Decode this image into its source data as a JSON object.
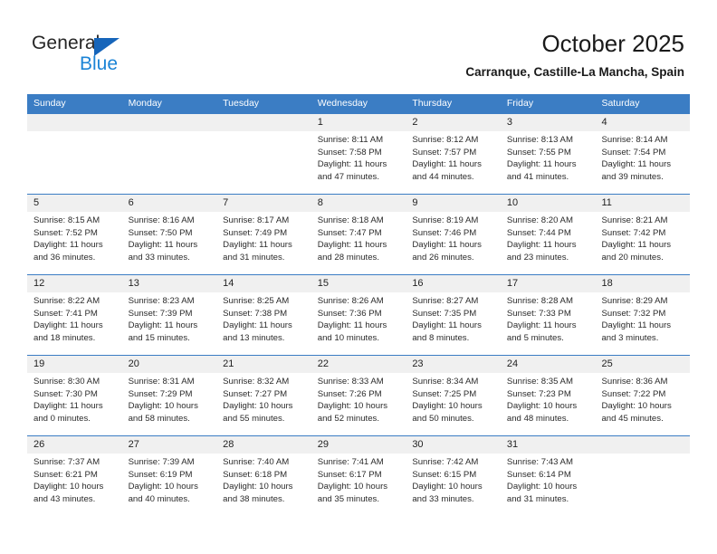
{
  "brand": {
    "name_part1": "General",
    "name_part2": "Blue",
    "triangle_color": "#1665ba",
    "blue_color": "#1c84d6"
  },
  "header": {
    "title": "October 2025",
    "subtitle": "Carranque, Castille-La Mancha, Spain"
  },
  "colors": {
    "header_blue": "#3b7dc4",
    "row_band_gray": "#f0f0f0",
    "text": "#2b2b2b"
  },
  "weekdays": [
    "Sunday",
    "Monday",
    "Tuesday",
    "Wednesday",
    "Thursday",
    "Friday",
    "Saturday"
  ],
  "labels": {
    "sunrise_prefix": "Sunrise: ",
    "sunset_prefix": "Sunset: ",
    "daylight_prefix": "Daylight: "
  },
  "weeks": [
    [
      {
        "day": "",
        "empty": true
      },
      {
        "day": "",
        "empty": true
      },
      {
        "day": "",
        "empty": true
      },
      {
        "day": "1",
        "sunrise": "Sunrise: 8:11 AM",
        "sunset": "Sunset: 7:58 PM",
        "daylight_1": "Daylight: 11 hours",
        "daylight_2": "and 47 minutes."
      },
      {
        "day": "2",
        "sunrise": "Sunrise: 8:12 AM",
        "sunset": "Sunset: 7:57 PM",
        "daylight_1": "Daylight: 11 hours",
        "daylight_2": "and 44 minutes."
      },
      {
        "day": "3",
        "sunrise": "Sunrise: 8:13 AM",
        "sunset": "Sunset: 7:55 PM",
        "daylight_1": "Daylight: 11 hours",
        "daylight_2": "and 41 minutes."
      },
      {
        "day": "4",
        "sunrise": "Sunrise: 8:14 AM",
        "sunset": "Sunset: 7:54 PM",
        "daylight_1": "Daylight: 11 hours",
        "daylight_2": "and 39 minutes."
      }
    ],
    [
      {
        "day": "5",
        "sunrise": "Sunrise: 8:15 AM",
        "sunset": "Sunset: 7:52 PM",
        "daylight_1": "Daylight: 11 hours",
        "daylight_2": "and 36 minutes."
      },
      {
        "day": "6",
        "sunrise": "Sunrise: 8:16 AM",
        "sunset": "Sunset: 7:50 PM",
        "daylight_1": "Daylight: 11 hours",
        "daylight_2": "and 33 minutes."
      },
      {
        "day": "7",
        "sunrise": "Sunrise: 8:17 AM",
        "sunset": "Sunset: 7:49 PM",
        "daylight_1": "Daylight: 11 hours",
        "daylight_2": "and 31 minutes."
      },
      {
        "day": "8",
        "sunrise": "Sunrise: 8:18 AM",
        "sunset": "Sunset: 7:47 PM",
        "daylight_1": "Daylight: 11 hours",
        "daylight_2": "and 28 minutes."
      },
      {
        "day": "9",
        "sunrise": "Sunrise: 8:19 AM",
        "sunset": "Sunset: 7:46 PM",
        "daylight_1": "Daylight: 11 hours",
        "daylight_2": "and 26 minutes."
      },
      {
        "day": "10",
        "sunrise": "Sunrise: 8:20 AM",
        "sunset": "Sunset: 7:44 PM",
        "daylight_1": "Daylight: 11 hours",
        "daylight_2": "and 23 minutes."
      },
      {
        "day": "11",
        "sunrise": "Sunrise: 8:21 AM",
        "sunset": "Sunset: 7:42 PM",
        "daylight_1": "Daylight: 11 hours",
        "daylight_2": "and 20 minutes."
      }
    ],
    [
      {
        "day": "12",
        "sunrise": "Sunrise: 8:22 AM",
        "sunset": "Sunset: 7:41 PM",
        "daylight_1": "Daylight: 11 hours",
        "daylight_2": "and 18 minutes."
      },
      {
        "day": "13",
        "sunrise": "Sunrise: 8:23 AM",
        "sunset": "Sunset: 7:39 PM",
        "daylight_1": "Daylight: 11 hours",
        "daylight_2": "and 15 minutes."
      },
      {
        "day": "14",
        "sunrise": "Sunrise: 8:25 AM",
        "sunset": "Sunset: 7:38 PM",
        "daylight_1": "Daylight: 11 hours",
        "daylight_2": "and 13 minutes."
      },
      {
        "day": "15",
        "sunrise": "Sunrise: 8:26 AM",
        "sunset": "Sunset: 7:36 PM",
        "daylight_1": "Daylight: 11 hours",
        "daylight_2": "and 10 minutes."
      },
      {
        "day": "16",
        "sunrise": "Sunrise: 8:27 AM",
        "sunset": "Sunset: 7:35 PM",
        "daylight_1": "Daylight: 11 hours",
        "daylight_2": "and 8 minutes."
      },
      {
        "day": "17",
        "sunrise": "Sunrise: 8:28 AM",
        "sunset": "Sunset: 7:33 PM",
        "daylight_1": "Daylight: 11 hours",
        "daylight_2": "and 5 minutes."
      },
      {
        "day": "18",
        "sunrise": "Sunrise: 8:29 AM",
        "sunset": "Sunset: 7:32 PM",
        "daylight_1": "Daylight: 11 hours",
        "daylight_2": "and 3 minutes."
      }
    ],
    [
      {
        "day": "19",
        "sunrise": "Sunrise: 8:30 AM",
        "sunset": "Sunset: 7:30 PM",
        "daylight_1": "Daylight: 11 hours",
        "daylight_2": "and 0 minutes."
      },
      {
        "day": "20",
        "sunrise": "Sunrise: 8:31 AM",
        "sunset": "Sunset: 7:29 PM",
        "daylight_1": "Daylight: 10 hours",
        "daylight_2": "and 58 minutes."
      },
      {
        "day": "21",
        "sunrise": "Sunrise: 8:32 AM",
        "sunset": "Sunset: 7:27 PM",
        "daylight_1": "Daylight: 10 hours",
        "daylight_2": "and 55 minutes."
      },
      {
        "day": "22",
        "sunrise": "Sunrise: 8:33 AM",
        "sunset": "Sunset: 7:26 PM",
        "daylight_1": "Daylight: 10 hours",
        "daylight_2": "and 52 minutes."
      },
      {
        "day": "23",
        "sunrise": "Sunrise: 8:34 AM",
        "sunset": "Sunset: 7:25 PM",
        "daylight_1": "Daylight: 10 hours",
        "daylight_2": "and 50 minutes."
      },
      {
        "day": "24",
        "sunrise": "Sunrise: 8:35 AM",
        "sunset": "Sunset: 7:23 PM",
        "daylight_1": "Daylight: 10 hours",
        "daylight_2": "and 48 minutes."
      },
      {
        "day": "25",
        "sunrise": "Sunrise: 8:36 AM",
        "sunset": "Sunset: 7:22 PM",
        "daylight_1": "Daylight: 10 hours",
        "daylight_2": "and 45 minutes."
      }
    ],
    [
      {
        "day": "26",
        "sunrise": "Sunrise: 7:37 AM",
        "sunset": "Sunset: 6:21 PM",
        "daylight_1": "Daylight: 10 hours",
        "daylight_2": "and 43 minutes."
      },
      {
        "day": "27",
        "sunrise": "Sunrise: 7:39 AM",
        "sunset": "Sunset: 6:19 PM",
        "daylight_1": "Daylight: 10 hours",
        "daylight_2": "and 40 minutes."
      },
      {
        "day": "28",
        "sunrise": "Sunrise: 7:40 AM",
        "sunset": "Sunset: 6:18 PM",
        "daylight_1": "Daylight: 10 hours",
        "daylight_2": "and 38 minutes."
      },
      {
        "day": "29",
        "sunrise": "Sunrise: 7:41 AM",
        "sunset": "Sunset: 6:17 PM",
        "daylight_1": "Daylight: 10 hours",
        "daylight_2": "and 35 minutes."
      },
      {
        "day": "30",
        "sunrise": "Sunrise: 7:42 AM",
        "sunset": "Sunset: 6:15 PM",
        "daylight_1": "Daylight: 10 hours",
        "daylight_2": "and 33 minutes."
      },
      {
        "day": "31",
        "sunrise": "Sunrise: 7:43 AM",
        "sunset": "Sunset: 6:14 PM",
        "daylight_1": "Daylight: 10 hours",
        "daylight_2": "and 31 minutes."
      },
      {
        "day": "",
        "empty": true
      }
    ]
  ]
}
